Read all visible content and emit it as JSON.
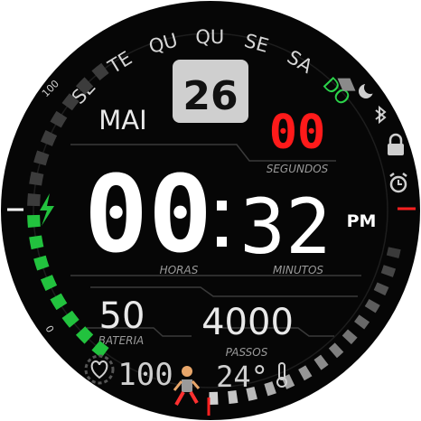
{
  "weekdays": {
    "items": [
      "SE",
      "TE",
      "QU",
      "QU",
      "SE",
      "SA",
      "DO"
    ],
    "active_index": 6,
    "active_color": "#2bd34a",
    "inactive_color": "#d6d6d6"
  },
  "date": {
    "day": "26",
    "month": "MAI"
  },
  "seconds": {
    "value": "00",
    "label": "SEGUNDOS",
    "color": "#ff1a1a"
  },
  "time": {
    "hours": "00",
    "minutes": "32",
    "ampm": "PM",
    "hours_label": "HORAS",
    "minutes_label": "MINUTOS"
  },
  "battery": {
    "value": "50",
    "label": "BATERIA",
    "level_percent": 50,
    "scale_top": "100",
    "scale_bottom": "0"
  },
  "steps": {
    "value": "4000",
    "label": "PASSOS"
  },
  "heart_rate": {
    "value": "100"
  },
  "temperature": {
    "value": "24°"
  },
  "status_icons": [
    "moon-icon",
    "bluetooth-icon",
    "lock-icon",
    "alarm-icon"
  ],
  "colors": {
    "accent_green": "#22c23e",
    "accent_red": "#ff1a1a",
    "text": "#e9e9e9",
    "label": "#9a9a9a"
  }
}
